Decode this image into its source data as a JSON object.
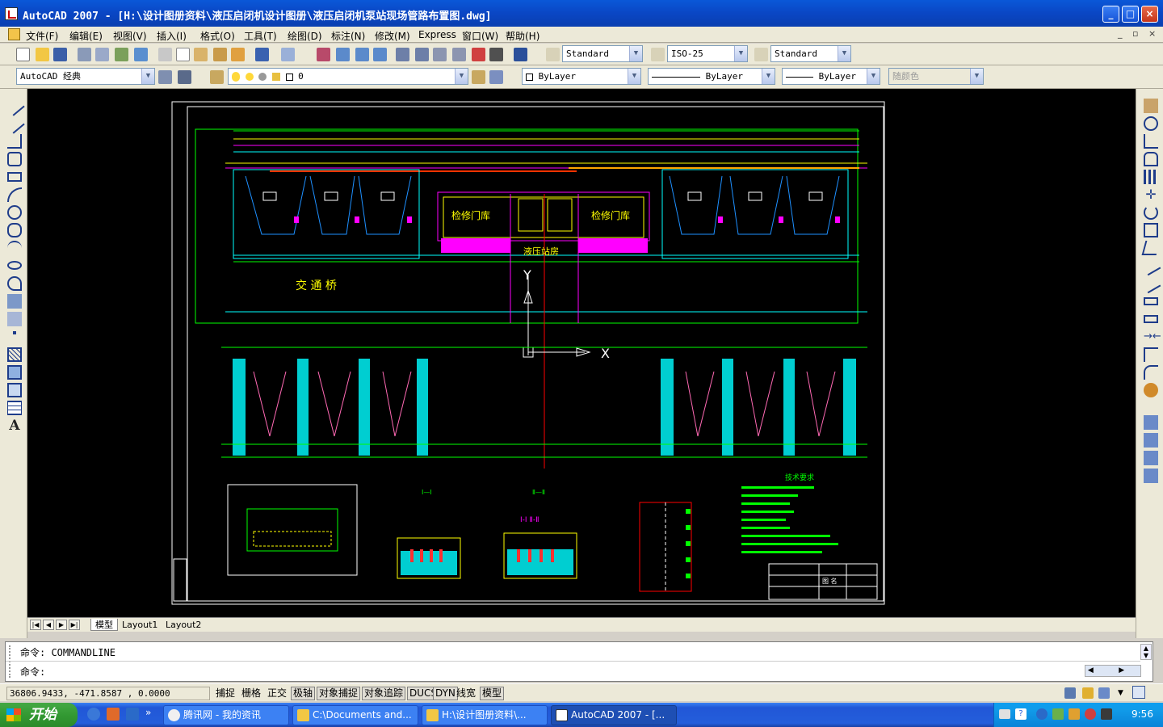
{
  "window": {
    "title": "AutoCAD 2007 - [H:\\设计图册资料\\液压启闭机设计图册\\液压启闭机泵站现场管路布置图.dwg]",
    "minimize": "_",
    "maximize": "□",
    "close": "×"
  },
  "menu": {
    "items": [
      "文件(F)",
      "编辑(E)",
      "视图(V)",
      "插入(I)",
      "格式(O)",
      "工具(T)",
      "绘图(D)",
      "标注(N)",
      "修改(M)",
      "Express",
      "窗口(W)",
      "帮助(H)"
    ],
    "doc_min": "_",
    "doc_restore": "▫",
    "doc_close": "×"
  },
  "toolbar": {
    "text_style": "Standard",
    "dim_style": "ISO-25",
    "table_style": "Standard",
    "workspace": "AutoCAD 经典",
    "layer": "0",
    "color": "ByLayer",
    "linetype": "ByLayer",
    "lineweight": "ByLayer",
    "plotstyle": "随颜色"
  },
  "drawing": {
    "label_door_left": "检修门库",
    "label_door_right": "检修门库",
    "label_pump": "液压站房",
    "label_bridge": "交 通 桥",
    "axis_y": "Y",
    "axis_x": "X",
    "section_a": "Ⅰ—Ⅰ",
    "section_b": "Ⅱ—Ⅱ",
    "section_label": "Ⅰ-Ⅰ Ⅱ-Ⅱ",
    "tech_title": "技术要求",
    "title_block": "图 名"
  },
  "layout_tabs": [
    "模型",
    "Layout1",
    "Layout2"
  ],
  "command": {
    "history": "命令: COMMANDLINE",
    "prompt": "命令:"
  },
  "status": {
    "coords": "36806.9433,  -471.8587  , 0.0000",
    "toggles": [
      "捕捉",
      "栅格",
      "正交",
      "极轴",
      "对象捕捉",
      "对象追踪",
      "DUCS",
      "DYN",
      "线宽",
      "模型"
    ]
  },
  "taskbar": {
    "start": "开始",
    "tasks": [
      "腾讯网 - 我的资讯",
      "C:\\Documents and...",
      "H:\\设计图册资料\\...",
      "AutoCAD 2007 - [..."
    ],
    "quicklaunch_more": "»",
    "clock": "9:56"
  },
  "colors": {
    "drawing_bg": "#000000",
    "xp_blue": "#245edb",
    "cad_cyan": "#00ffff",
    "cad_magenta": "#ff00ff",
    "cad_yellow": "#ffff00",
    "cad_green": "#00ff00"
  }
}
